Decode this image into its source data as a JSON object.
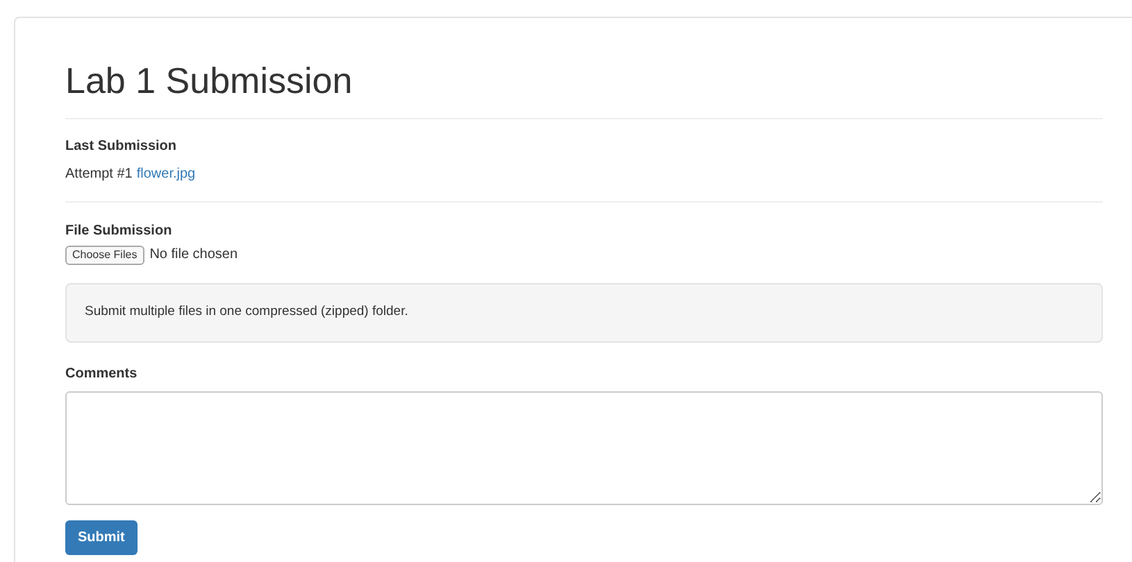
{
  "title": "Lab 1 Submission",
  "last_submission": {
    "label": "Last Submission",
    "attempt": "Attempt #1",
    "file_link": "flower.jpg"
  },
  "file_submission": {
    "label": "File Submission",
    "button": "Choose Files",
    "status": "No file chosen"
  },
  "notice": "Submit multiple files in one compressed (zipped) folder.",
  "comments": {
    "label": "Comments"
  },
  "submit_button": "Submit"
}
